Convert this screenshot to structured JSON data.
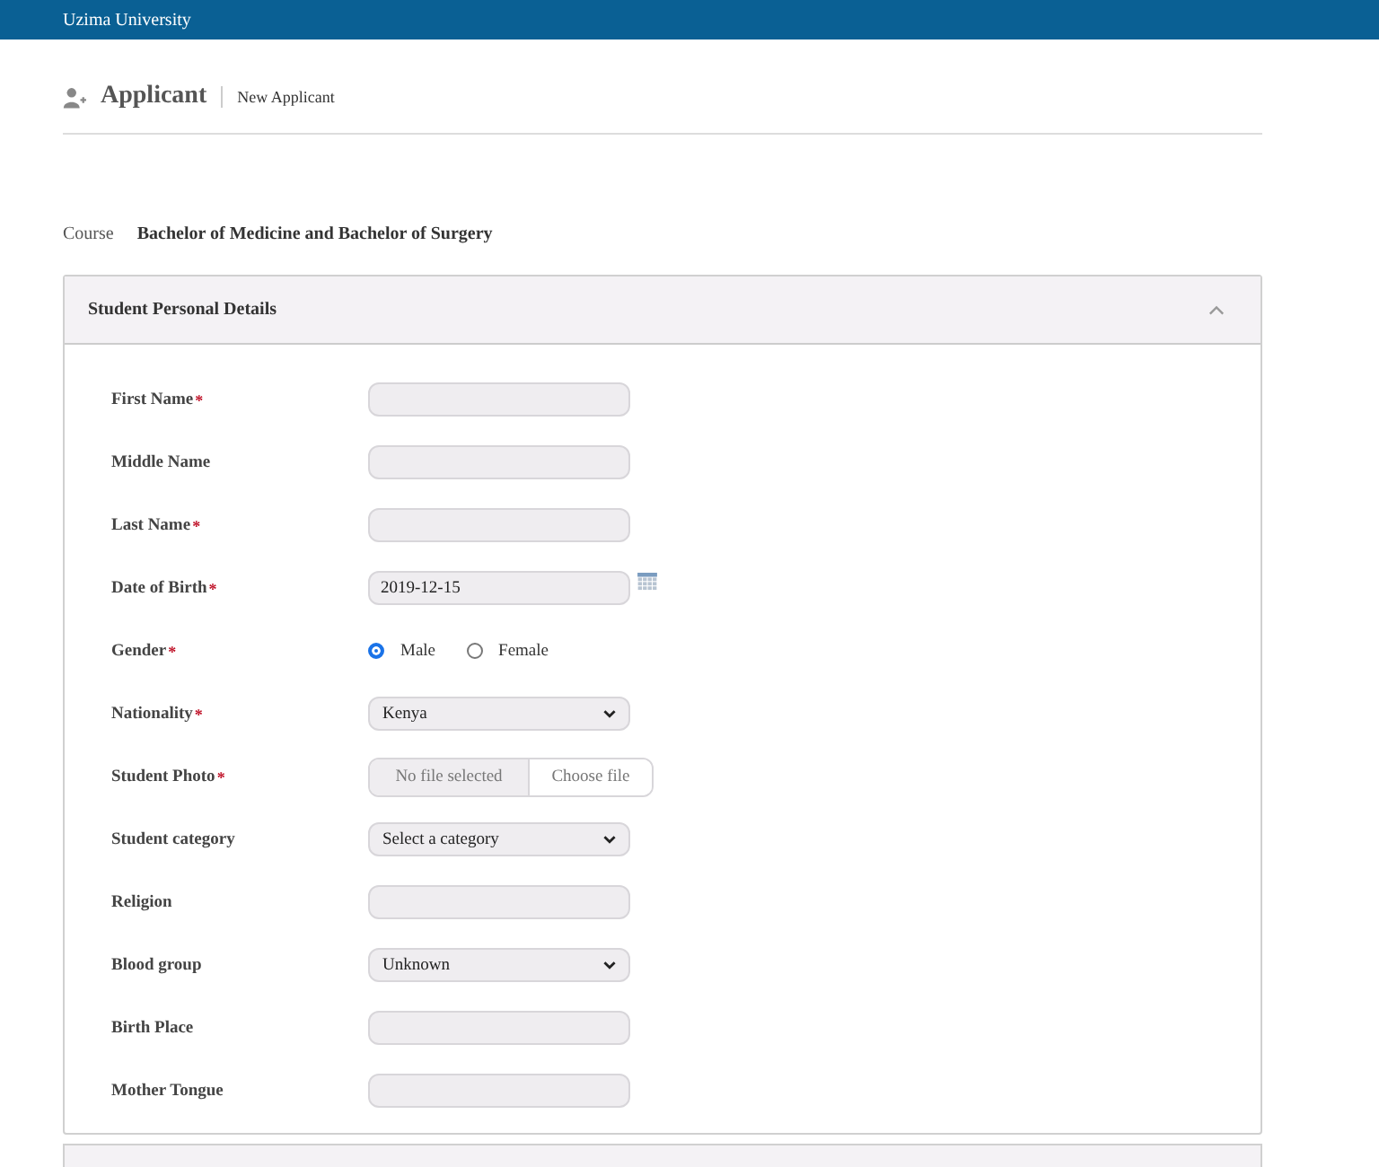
{
  "top_bar": {
    "title": "Uzima University"
  },
  "page_header": {
    "title": "Applicant",
    "subtitle": "New Applicant"
  },
  "course": {
    "label": "Course",
    "value": "Bachelor of Medicine and Bachelor of Surgery"
  },
  "panel": {
    "title": "Student Personal Details",
    "expanded": true,
    "fields": [
      {
        "kind": "text",
        "label": "First Name",
        "required_mark": "*"
      },
      {
        "kind": "text",
        "label": "Middle Name"
      },
      {
        "kind": "text",
        "label": "Last Name",
        "required_mark": "*"
      },
      {
        "kind": "date",
        "label": "Date of Birth",
        "required_mark": "*",
        "value": "2019-12-15"
      },
      {
        "kind": "radio",
        "label": "Gender",
        "required_mark": "*",
        "options": [
          {
            "label": "Male",
            "selected": true
          },
          {
            "label": "Female",
            "selected": false
          }
        ]
      },
      {
        "kind": "select",
        "label": "Nationality",
        "required_mark": "*",
        "value": "Kenya"
      },
      {
        "kind": "file",
        "label": "Student Photo",
        "required_mark": "*",
        "status": "No file selected",
        "button": "Choose file"
      },
      {
        "kind": "select",
        "label": "Student category",
        "value": "Select a category"
      },
      {
        "kind": "text",
        "label": "Religion"
      },
      {
        "kind": "select",
        "label": "Blood group",
        "value": "Unknown"
      },
      {
        "kind": "text",
        "label": "Birth Place"
      },
      {
        "kind": "text",
        "label": "Mother Tongue"
      }
    ]
  }
}
